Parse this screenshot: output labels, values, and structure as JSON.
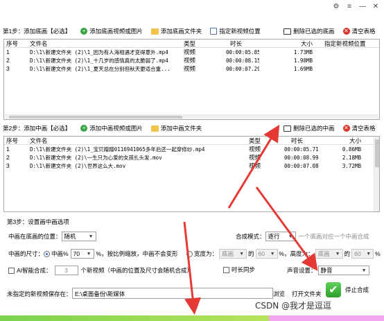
{
  "step1": {
    "title": "第1步：添加底画【必选】",
    "add_video": "添加底画视频或图片",
    "add_folder": "添加底画文件夹",
    "set_location": "指定新视频位置",
    "remove_selected": "删除已选的底画",
    "clear_table": "清空表格",
    "columns": [
      "序号",
      "文件名",
      "类型",
      "时长",
      "大小",
      "指定新视频位置"
    ],
    "rows": [
      {
        "no": "1",
        "file": "D:\\1\\新建文件夹 (2)\\1_因为有人海相遇才变得意外.mp4",
        "type": "视频",
        "duration": "00:00:05.85",
        "size": "1.73MB",
        "location": ""
      },
      {
        "no": "2",
        "file": "D:\\1\\新建文件夹 (2)\\1_十几岁的感情真的太脆弱了.mp4",
        "type": "视频",
        "duration": "00:00:08.15",
        "size": "1.98MB",
        "location": ""
      },
      {
        "no": "3",
        "file": "D:\\1\\新建文件夹 (2)\\1_夏天总在分别但秋天更适合重...",
        "type": "视频",
        "duration": "00:00:07.29",
        "size": "1.69MB",
        "location": ""
      }
    ]
  },
  "step2": {
    "title": "第2步：添加中画【必选】",
    "add_video": "添加中画视频或图片",
    "add_folder": "添加中画文件夹",
    "remove_selected": "删除已选的中画",
    "clear_table": "清空表格",
    "columns": [
      "序号",
      "文件名",
      "类型",
      "时长",
      "大小"
    ],
    "rows": [
      {
        "no": "1",
        "file": "D:\\1\\新建文件夹 (2)\\1_宝贝蹭蹭0116941065多年后还一起穿修纱.mp4",
        "type": "视频",
        "duration": "00:00:05.71",
        "size": "0.86MB"
      },
      {
        "no": "2",
        "file": "D:\\1\\新建文件夹 (2)\\一生只为心爱的女孩扎头发.mov",
        "type": "视频",
        "duration": "00:00:08.99",
        "size": "2.18MB"
      },
      {
        "no": "3",
        "file": "D:\\1\\新建文件夹 (2)\\世界这么大.mov",
        "type": "视频",
        "duration": "00:00:07.08",
        "size": "3.72MB"
      }
    ]
  },
  "step3": {
    "title": "第3步：设置画中画选项",
    "position_label": "中画在底画的位置：",
    "position_value": "随机",
    "blend_label": "合成模式：",
    "blend_value": "逐行",
    "blend_hint": "一个底画对应一个中画合成",
    "size_label": "中画的尺寸：",
    "ratio_label": "中画%",
    "ratio_value": "70",
    "ratio_hint": "%，按比例缩放，中画不会变形",
    "width_label": "宽度为：",
    "width_sel": "底画",
    "width_of": "的",
    "width_value": "60",
    "width_pct": "%",
    "height_label": "，高度为：",
    "height_sel": "底画",
    "height_of": "的",
    "height_value": "60",
    "height_pct": "%",
    "ai_label": "AI智能合成：",
    "ai_count": "3",
    "ai_hint": "个新视频（中画的位置及尺寸会随机合成）",
    "sync_label": "时长同步",
    "audio_label": "声音设置：",
    "audio_value": "静音"
  },
  "output": {
    "save_label": "未指定的新视频保存在：",
    "save_path": "E:\\桌面备份\\新媒体",
    "browse": "浏览",
    "open_folder": "打开文件夹",
    "stop": "停止合成"
  },
  "watermark": "CSDN @我才是逗逗",
  "colors": {
    "arrow": "#e53935",
    "progress_green": "#7ad24d",
    "progress_pink": "#f2a6ef"
  }
}
